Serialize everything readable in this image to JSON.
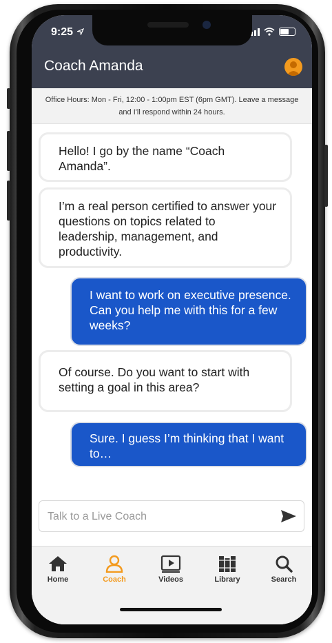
{
  "status": {
    "time": "9:25"
  },
  "header": {
    "title": "Coach Amanda"
  },
  "info": {
    "office_hours": "Office Hours: Mon - Fri, 12:00 - 1:00pm EST (6pm GMT). Leave a message and I'll respond within 24 hours."
  },
  "messages": [
    {
      "sender": "coach",
      "text": "Hello! I go by the name “Coach Amanda”."
    },
    {
      "sender": "coach",
      "text": "I’m a real person certified to answer your questions on topics related to leadership, management, and productivity."
    },
    {
      "sender": "user",
      "text": "I want to work on executive presence. Can you help me with this for a few weeks?"
    },
    {
      "sender": "coach",
      "text": "Of course. Do you want to start with setting a goal in this area?"
    },
    {
      "sender": "user",
      "text": "Sure. I guess I’m thinking that I want to…"
    }
  ],
  "composer": {
    "placeholder": "Talk to a Live Coach"
  },
  "tabs": [
    {
      "label": "Home",
      "icon": "home-icon"
    },
    {
      "label": "Coach",
      "icon": "coach-icon",
      "active": true
    },
    {
      "label": "Videos",
      "icon": "videos-icon"
    },
    {
      "label": "Library",
      "icon": "library-icon"
    },
    {
      "label": "Search",
      "icon": "search-icon"
    }
  ],
  "colors": {
    "header": "#3c4150",
    "accent": "#f39a1e",
    "user_bubble": "#1a57c9"
  }
}
